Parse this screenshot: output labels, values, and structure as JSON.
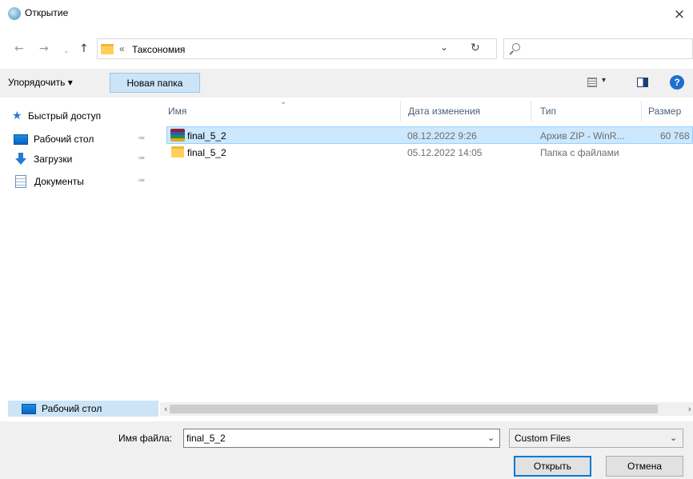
{
  "window": {
    "title": "Открытие",
    "close_glyph": "×"
  },
  "nav": {
    "back_glyph": "←",
    "forward_glyph": "→",
    "recent_glyph": "⌄",
    "up_glyph": "↑",
    "address_separator": "«",
    "address_path": "Таксономия",
    "address_dropdown_glyph": "⌄",
    "refresh_glyph": "↻",
    "search_placeholder": ""
  },
  "toolbar": {
    "organize_label": "Упорядочить ▾",
    "new_folder_label": "Новая папка",
    "view_dropdown_glyph": "▾",
    "help_glyph": "?"
  },
  "sidebar": {
    "items": [
      {
        "label": "Быстрый доступ",
        "icon": "star-icon"
      },
      {
        "label": "Рабочий стол",
        "icon": "desktop-icon",
        "pinned": true
      },
      {
        "label": "Загрузки",
        "icon": "download-icon",
        "pinned": true
      },
      {
        "label": "Документы",
        "icon": "documents-icon",
        "pinned": true
      }
    ],
    "pin_glyph": "✑",
    "bottom_item": {
      "label": "Рабочий стол",
      "icon": "desktop-icon"
    }
  },
  "file_list": {
    "columns": [
      "Имя",
      "Дата изменения",
      "Тип",
      "Размер"
    ],
    "sort_glyph": "⌄",
    "rows": [
      {
        "name": "final_5_2",
        "date": "08.12.2022 9:26",
        "type": "Архив ZIP - WinR...",
        "size": "60 768",
        "icon": "winrar-archive-icon",
        "selected": true
      },
      {
        "name": "final_5_2",
        "date": "05.12.2022 14:05",
        "type": "Папка с файлами",
        "size": "",
        "icon": "folder-icon",
        "selected": false
      }
    ]
  },
  "scrollbar": {
    "left_glyph": "‹",
    "right_glyph": "›"
  },
  "bottom": {
    "filename_label": "Имя файла:",
    "filename_value": "final_5_2",
    "filename_dropdown_glyph": "⌄",
    "filter_value": "Custom Files",
    "filter_dropdown_glyph": "⌄",
    "open_label": "Открыть",
    "cancel_label": "Отмена"
  }
}
